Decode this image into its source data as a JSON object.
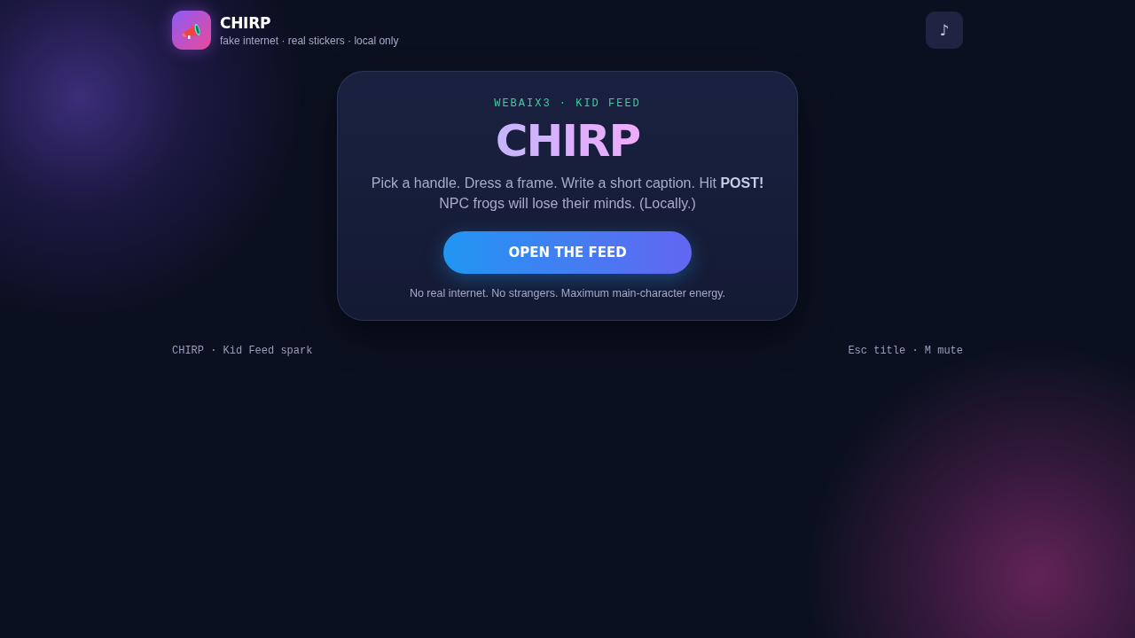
{
  "header": {
    "title": "CHIRP",
    "tagline": "fake internet · real stickers · local only",
    "music_button": "♪"
  },
  "card": {
    "eyebrow": "WEBAIX3 · KID FEED",
    "title": "CHIRP",
    "description": "Pick a handle. Dress a frame. Write a short caption. Hit **POST!** NPC frogs will lose their minds. (Locally.)",
    "button": "OPEN THE FEED",
    "note": "No real internet. No strangers. Maximum main-character energy."
  },
  "footer": {
    "left": "CHIRP · Kid Feed spark",
    "right": "Esc title · M mute"
  }
}
